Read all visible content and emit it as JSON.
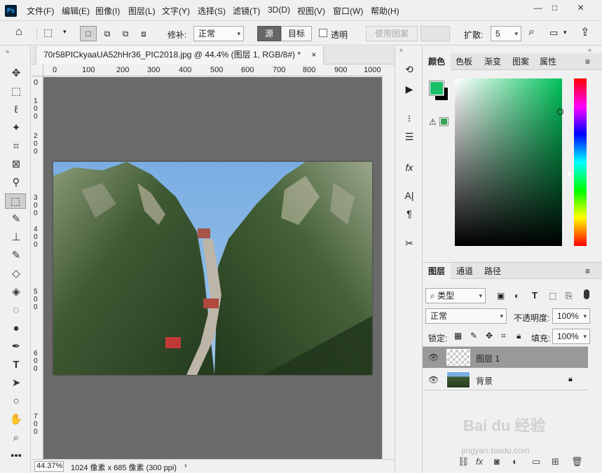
{
  "app": {
    "logo": "Ps"
  },
  "menu": [
    "文件(F)",
    "编辑(E)",
    "图像(I)",
    "图层(L)",
    "文字(Y)",
    "选择(S)",
    "滤镜(T)",
    "3D(D)",
    "视图(V)",
    "窗口(W)",
    "帮助(H)"
  ],
  "window_controls": {
    "minimize": "—",
    "restore": "□",
    "close": "✕"
  },
  "options": {
    "home_icon": "home-icon",
    "repair_label": "修补:",
    "repair_mode": "正常",
    "source_label": "源",
    "target_label": "目标",
    "transparent_label": "透明",
    "use_pattern_label": "使用图案",
    "diffuse_label": "扩散:",
    "diffuse_value": "5"
  },
  "document": {
    "tab_title": "70r58PICkyaaUA52hHr36_PIC2018.jpg @ 44.4% (图层 1, RGB/8#) *",
    "close": "×",
    "zoom": "44.37%",
    "info": "1024 像素 x 685 像素 (300 ppi)",
    "hruler": [
      "0",
      "100",
      "200",
      "300",
      "400",
      "500",
      "600",
      "700",
      "800",
      "900",
      "1000"
    ],
    "vruler": [
      "0",
      "1 0 0",
      "2 0 0",
      "3 0 0",
      "4 0 0",
      "5 0 0",
      "6 0 0",
      "7 0 0"
    ]
  },
  "color_panel": {
    "tabs": [
      "颜色",
      "色板",
      "渐变",
      "图案",
      "属性"
    ],
    "foreground": "#1bbf6a",
    "background": "#000000",
    "warning_swatch": "#3ba55c"
  },
  "layers_panel": {
    "tabs": [
      "图层",
      "通道",
      "路径"
    ],
    "filter_label": "类型",
    "blend_mode": "正常",
    "opacity_label": "不透明度:",
    "opacity_value": "100%",
    "lock_label": "锁定:",
    "fill_label": "填充:",
    "fill_value": "100%",
    "layers": [
      {
        "name": "图层 1",
        "selected": true
      },
      {
        "name": "背景",
        "locked": true
      }
    ]
  },
  "watermark": {
    "text": "Bai du 经验",
    "url": "jingyan.baidu.com"
  }
}
